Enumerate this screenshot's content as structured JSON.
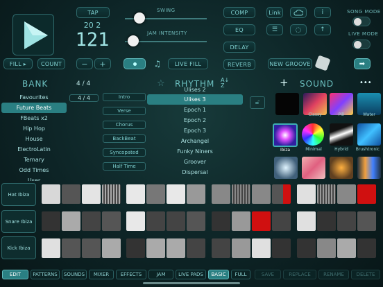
{
  "transport": {
    "tap": "TAP",
    "beat_display": "20 2",
    "tempo": "121",
    "fill": "FILL ▸",
    "count": "COUNT",
    "minus": "−",
    "plus": "+",
    "live_fill": "LIVE FILL"
  },
  "sliders": {
    "swing": "SWING",
    "jam_intensity": "JAM INTENSITY"
  },
  "fx": {
    "comp": "COMP",
    "eq": "EQ",
    "delay": "DELAY",
    "reverb": "REVERB",
    "link": "Link",
    "new_groove": "NEW GROOVE"
  },
  "modes": {
    "song_mode": "SONG MODE",
    "live_mode": "LIVE MODE"
  },
  "headers": {
    "bank": "BANK",
    "bank_count": "4 / 4",
    "rhythm": "RHYTHM",
    "sound": "SOUND",
    "more": "•••",
    "plus": "+"
  },
  "bank_items": [
    "Favourites",
    "Future Beats",
    "FBeats x2",
    "Hip Hop",
    "House",
    "ElectroLatin",
    "Ternary",
    "Odd Times",
    "User"
  ],
  "time_sig": "4 / 4",
  "styles": [
    "Intro",
    "Verse",
    "Chorus",
    "BackBeat",
    "Syncopated",
    "Half Time"
  ],
  "rhythm_items": [
    "Ulises 2",
    "Ulises 3",
    "Epoch 1",
    "Epoch 2",
    "Epoch 3",
    "Archangel",
    "Funky Niners",
    "Groover",
    "Dispersal"
  ],
  "sounds": [
    {
      "name": ""
    },
    {
      "name": "Classy"
    },
    {
      "name": "Pill"
    },
    {
      "name": "Water"
    },
    {
      "name": "Ibiza"
    },
    {
      "name": "Minimal"
    },
    {
      "name": "Hybrid"
    },
    {
      "name": "Brushtronic"
    },
    {
      "name": ""
    },
    {
      "name": ""
    },
    {
      "name": ""
    },
    {
      "name": ""
    }
  ],
  "tracks": [
    "Hat Ibiza",
    "Snare Ibiza",
    "Kick Ibiza"
  ],
  "tabs": {
    "edit": "EDIT",
    "patterns": "PATTERNS",
    "sounds": "SOUNDS",
    "mixer": "MIXER",
    "effects": "EFFECTS",
    "jam": "JAM",
    "live_pads": "LIVE PADS",
    "basic": "BASIC",
    "full": "FULL",
    "save": "SAVE",
    "replace": "REPLACE",
    "rename": "RENAME",
    "delete": "DELETE"
  },
  "colors": {
    "accent": "#2a7f82",
    "red": "#d01010"
  }
}
